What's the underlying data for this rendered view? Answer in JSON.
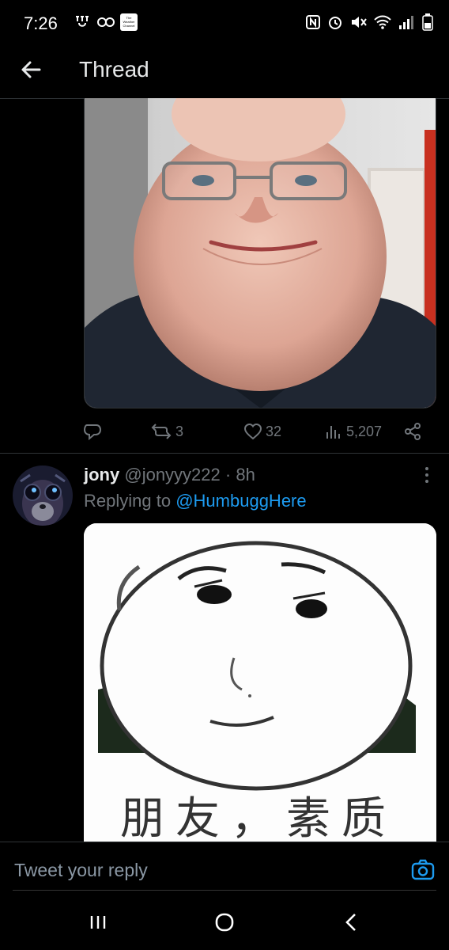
{
  "status_bar": {
    "time": "7:26",
    "weather_app_label": "The Weather Channel"
  },
  "header": {
    "title": "Thread",
    "back_icon": "arrow-left-icon"
  },
  "tweet1": {
    "actions": {
      "retweets": "3",
      "likes": "32",
      "views": "5,207"
    }
  },
  "tweet2": {
    "author_name": "jony",
    "author_handle": "@jonyyy222",
    "separator": "·",
    "time": "8h",
    "replying_prefix": "Replying to",
    "replying_handle": "@HumbuggHere",
    "image_caption": "朋友，素质"
  },
  "composer": {
    "placeholder": "Tweet your reply"
  },
  "colors": {
    "background": "#000000",
    "accent": "#1d9bf0",
    "muted": "#71767b",
    "divider": "#2f3336"
  }
}
